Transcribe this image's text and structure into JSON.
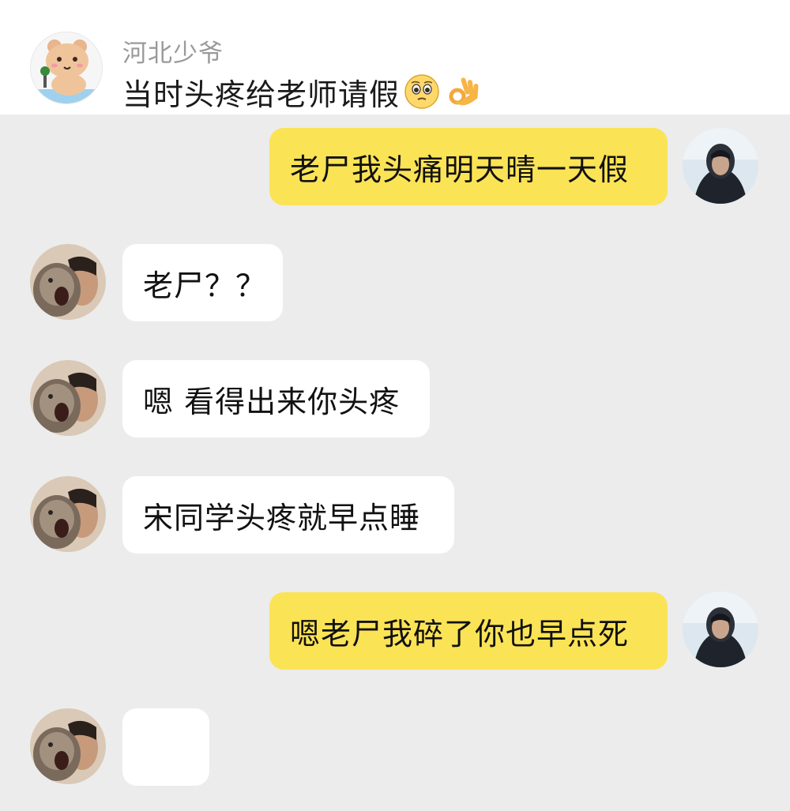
{
  "post": {
    "author_name": "河北少爷",
    "text": "当时头疼给老师请假",
    "emojis": [
      "pleading-face-icon",
      "ok-hand-icon"
    ]
  },
  "chat": {
    "colors": {
      "background": "#ececec",
      "self_bubble": "#fbe356",
      "other_bubble": "#ffffff"
    },
    "messages": [
      {
        "sender": "self",
        "text": "老尸我头痛明天晴一天假"
      },
      {
        "sender": "other",
        "text": "老尸？？"
      },
      {
        "sender": "other",
        "text": "嗯 看得出来你头疼"
      },
      {
        "sender": "other",
        "text": "宋同学头疼就早点睡"
      },
      {
        "sender": "self",
        "text": "嗯老尸我碎了你也早点死"
      },
      {
        "sender": "other",
        "text": ""
      }
    ]
  }
}
